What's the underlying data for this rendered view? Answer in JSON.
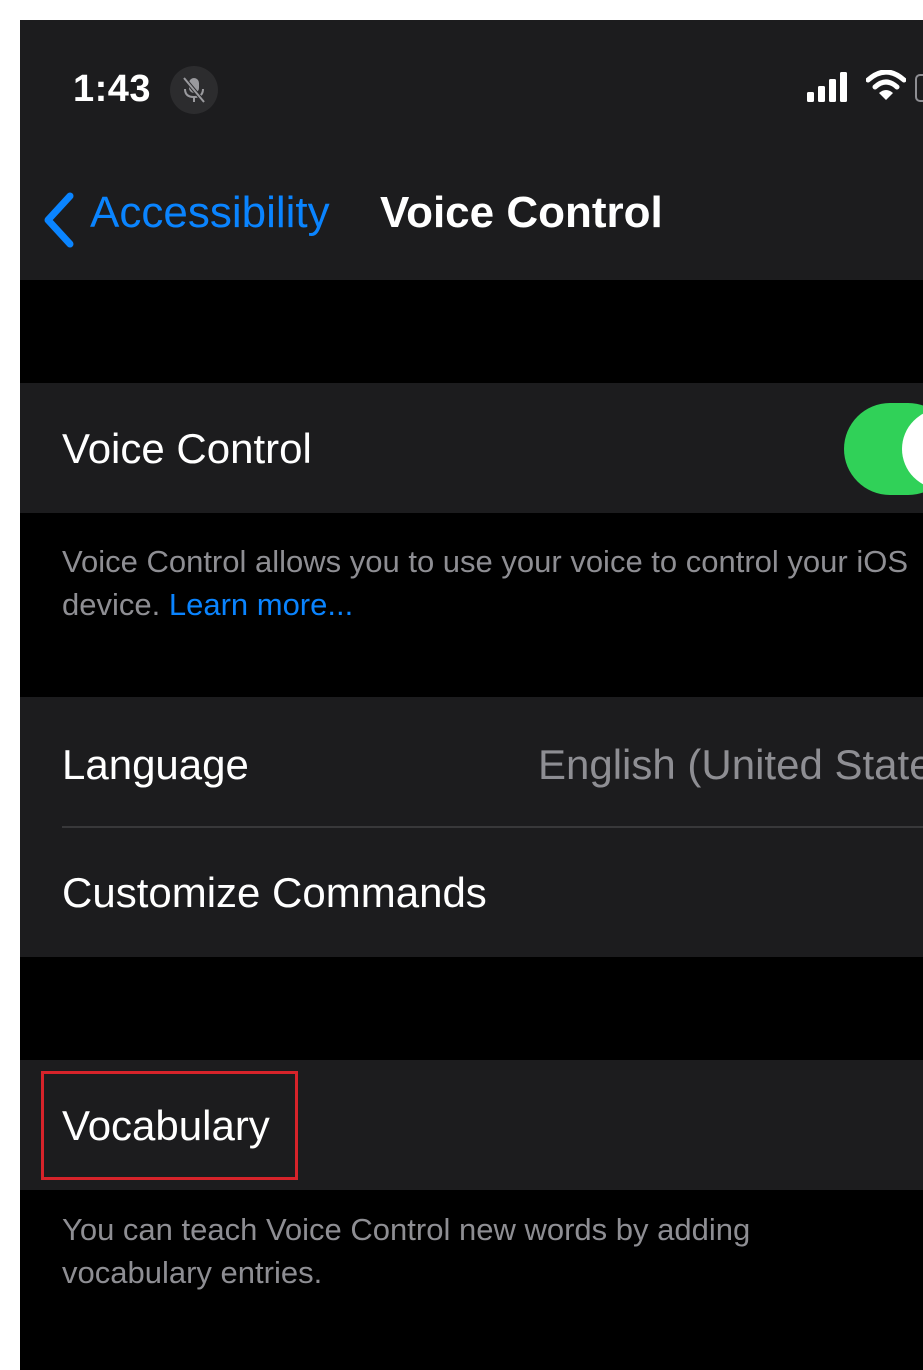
{
  "status_bar": {
    "time": "1:43",
    "mic_icon": "mic-muted-icon",
    "signal_icon": "cellular-signal-icon",
    "wifi_icon": "wifi-icon",
    "battery_icon": "battery-icon"
  },
  "nav": {
    "back_label": "Accessibility",
    "back_icon": "chevron-left-icon",
    "title": "Voice Control"
  },
  "voice_control_section": {
    "label": "Voice Control",
    "toggle_on": true,
    "footer_text": "Voice Control allows you to use your voice to control your iOS device. ",
    "footer_link": "Learn more..."
  },
  "settings_section": {
    "language_label": "Language",
    "language_value": "English (United States)",
    "customize_label": "Customize Commands"
  },
  "vocabulary_section": {
    "label": "Vocabulary",
    "footer_text": "You can teach Voice Control new words by adding vocabulary entries."
  },
  "colors": {
    "accent": "#0a84ff",
    "toggle_on": "#30d158",
    "highlight": "#d6232a",
    "cell_background": "#1c1c1e",
    "screen_background": "#000000"
  }
}
